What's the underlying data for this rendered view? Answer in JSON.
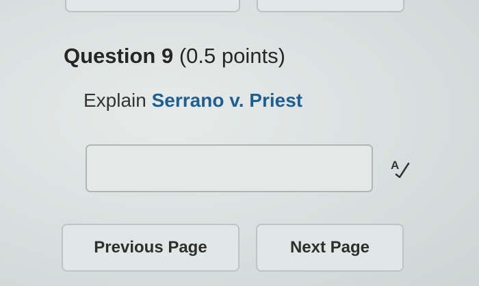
{
  "question": {
    "label": "Question 9",
    "points": "(0.5 points)",
    "prompt_prefix": "Explain ",
    "prompt_topic": "Serrano v. Priest"
  },
  "answer": {
    "value": ""
  },
  "icons": {
    "spellcheck": "spellcheck-icon"
  },
  "navigation": {
    "previous_label": "Previous Page",
    "next_label": "Next Page"
  },
  "colors": {
    "background": "#d9dfdf",
    "topic_link": "#1f5f8f",
    "text": "#262626",
    "border": "#aeb6b6"
  }
}
